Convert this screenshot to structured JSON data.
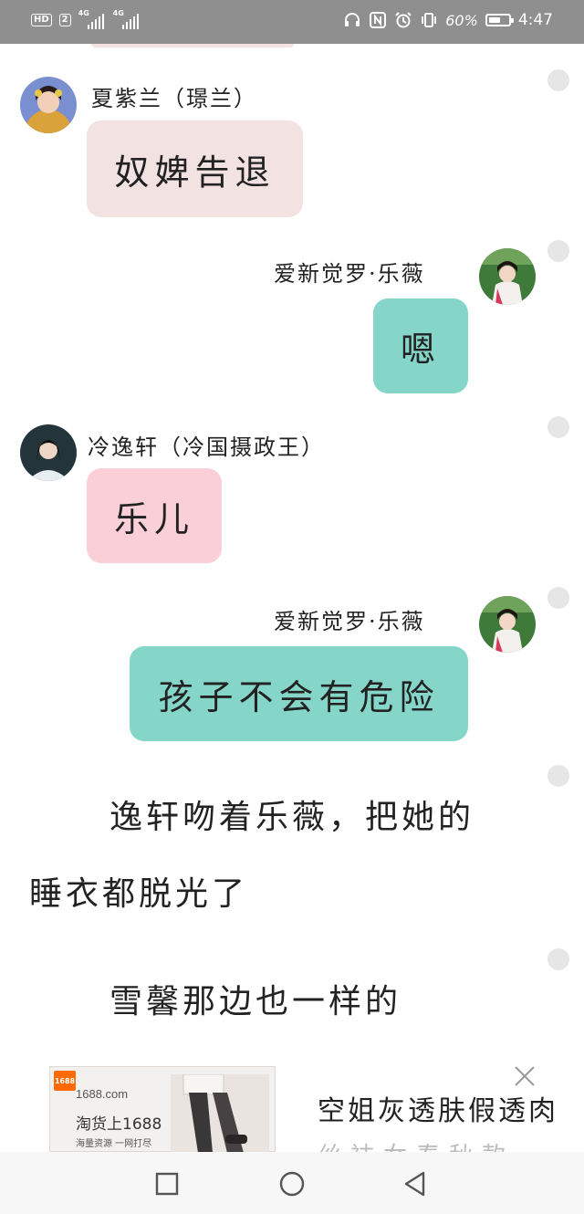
{
  "status_bar": {
    "hd": "HD",
    "sim1_tag": "4G",
    "sim2_tag": "4G",
    "sim_index": "2",
    "battery": "60%",
    "battery_level": 0.6,
    "time": "4:47"
  },
  "messages": [
    {
      "sender": "夏紫兰（璟兰）",
      "text": "奴婢告退",
      "side": "left",
      "bubble_color": "#f2e2e2"
    },
    {
      "sender": "爱新觉罗·乐薇",
      "text": "嗯",
      "side": "right",
      "bubble_color": "#85d6c9"
    },
    {
      "sender": "冷逸轩（冷国摄政王）",
      "text": "乐儿",
      "side": "left",
      "bubble_color": "#fbcfd8"
    },
    {
      "sender": "爱新觉罗·乐薇",
      "text": "孩子不会有危险",
      "side": "right",
      "bubble_color": "#85d6c9"
    }
  ],
  "narration": {
    "line1": "逸轩吻着乐薇，把她的",
    "line2": "睡衣都脱光了",
    "line3": "雪馨那边也一样的"
  },
  "ad": {
    "logo": "1688",
    "site": "1688.com",
    "slogan": "淘货上1688",
    "sub": "海量资源 一网打尽",
    "title": "空姐灰透肤假透肉",
    "title2": "丝袜女春秋款"
  },
  "nav": {
    "recent": "square-icon",
    "home": "circle-icon",
    "back": "triangle-back-icon"
  }
}
